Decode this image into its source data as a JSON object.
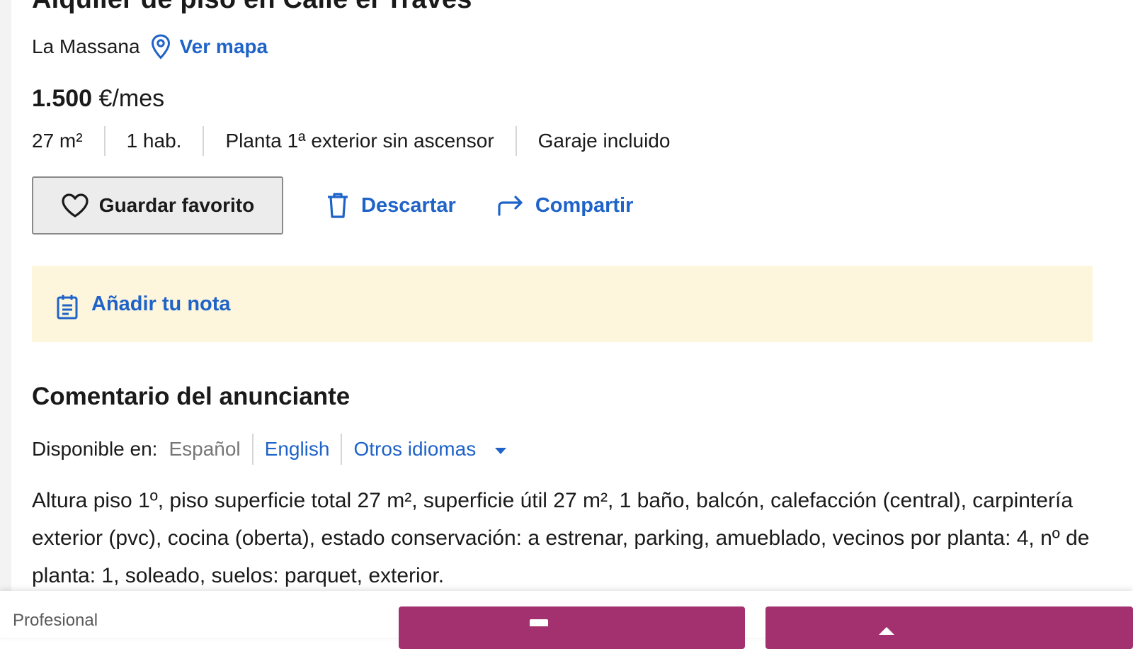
{
  "listing": {
    "title": "Alquiler de piso en Calle el Traves",
    "location": "La Massana",
    "map_link": "Ver mapa",
    "price_amount": "1.500",
    "price_unit": "€/mes",
    "features": [
      "27 m²",
      "1 hab.",
      "Planta 1ª exterior sin ascensor",
      "Garaje incluido"
    ]
  },
  "actions": {
    "favorite": "Guardar favorito",
    "discard": "Descartar",
    "share": "Compartir"
  },
  "note": {
    "link": "Añadir tu nota"
  },
  "comment": {
    "title": "Comentario del anunciante",
    "available_label": "Disponible en:",
    "languages": [
      "Español",
      "English",
      "Otros idiomas"
    ],
    "text": "Altura piso 1º, piso superficie total 27 m², superficie útil 27 m², 1 baño, balcón, calefacción (central), carpintería exterior (pvc), cocina (oberta), estado conservación: a estrenar, parking, amueblado, vecinos por planta: 4, nº de planta: 1, soleado, suelos: parquet, exterior."
  },
  "bottom_bar": {
    "label": "Profesional"
  },
  "colors": {
    "link": "#1f63c8",
    "note_bg": "#fdf6dd",
    "cta": "#a3306f"
  },
  "icons": [
    "location-pin-icon",
    "heart-icon",
    "trash-icon",
    "share-arrow-icon",
    "notepad-icon",
    "caret-down-icon"
  ]
}
